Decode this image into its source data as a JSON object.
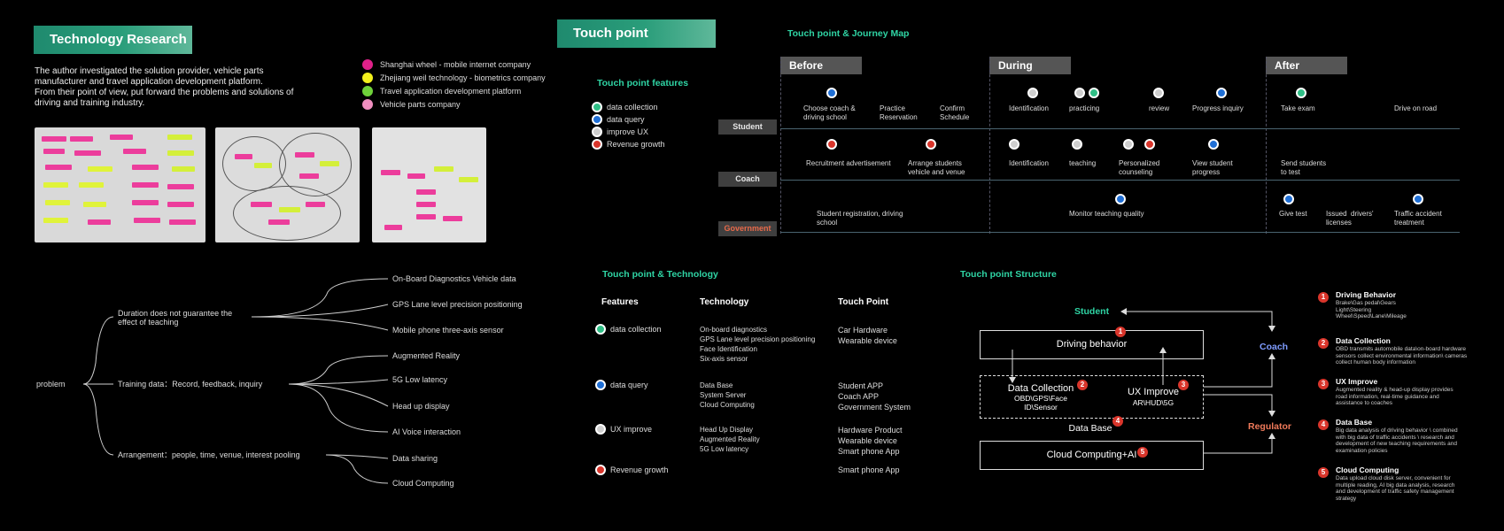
{
  "tech_research": {
    "header": "Technology Research",
    "intro": [
      "The author investigated the solution provider, vehicle parts",
      "manufacturer and travel application development platform.",
      "From their point of view, put forward the problems and solutions of",
      "driving and training industry."
    ],
    "legend": [
      {
        "label": "Shanghai wheel - mobile internet company",
        "color": "#e0218a"
      },
      {
        "label": "Zhejiang weil technology - biometrics company",
        "color": "#f2f01c"
      },
      {
        "label": "Travel application development platform",
        "color": "#6fd13a"
      },
      {
        "label": "Vehicle parts company",
        "color": "#f08fc0"
      }
    ]
  },
  "problem_tree": {
    "root": "problem",
    "branches": [
      {
        "label": "Duration does not guarantee the\neffect of teaching",
        "leaves": [
          "On-Board Diagnostics Vehicle data",
          "GPS Lane level precision positioning",
          "Mobile phone three-axis sensor"
        ]
      },
      {
        "label": "Training data：Record, feedback, inquiry",
        "leaves": [
          "Augmented Reality",
          "5G Low latency",
          "Head up display",
          "AI Voice interaction"
        ]
      },
      {
        "label": "Arrangement：people, time, venue,  interest pooling",
        "leaves": [
          "Data sharing",
          "Cloud Computing"
        ]
      }
    ]
  },
  "touch_point": {
    "header": "Touch point",
    "features_title": "Touch point features",
    "features": [
      {
        "label": "data collection",
        "color": "green"
      },
      {
        "label": "data query",
        "color": "blue"
      },
      {
        "label": "improve UX",
        "color": "white"
      },
      {
        "label": "Revenue growth",
        "color": "red"
      }
    ]
  },
  "journey": {
    "title": "Touch point & Journey Map",
    "phases": [
      "Before",
      "During",
      "After"
    ],
    "roles": [
      "Student",
      "Coach",
      "Government"
    ],
    "student": [
      "Choose coach &\ndriving school",
      "Practice\nReservation",
      "Confirm\nSchedule",
      "Identification",
      "practicing",
      "review",
      "Progress inquiry",
      "Take exam",
      "Drive on road"
    ],
    "coach": [
      "Recruitment advertisement",
      "Arrange students\nvehicle and venue",
      "Identification",
      "teaching",
      "Personalized\ncounseling",
      "View student\nprogress",
      "Send students\nto test"
    ],
    "government": [
      "Student registration, driving\nschool",
      "Monitor teaching quality",
      "Give test",
      "Issued  drivers'\nlicenses",
      "Traffic accident\ntreatment"
    ]
  },
  "tech_table": {
    "title": "Touch point & Technology",
    "headers": [
      "Features",
      "Technology",
      "Touch Point"
    ],
    "rows": [
      {
        "feature": "data collection",
        "color": "green",
        "tech": [
          "On-board diagnostics",
          "GPS Lane level precision positioning",
          "Face Identification",
          "Six-axis sensor"
        ],
        "touch": [
          "Car Hardware",
          "Wearable device"
        ]
      },
      {
        "feature": "data query",
        "color": "blue",
        "tech": [
          "Data Base",
          "System Server",
          "Cloud Computing"
        ],
        "touch": [
          "Student APP",
          "Coach APP",
          "Government System"
        ]
      },
      {
        "feature": "UX improve",
        "color": "white",
        "tech": [
          "Head Up Display",
          "Augmented Reality",
          "5G Low latency"
        ],
        "touch": [
          "Hardware Product",
          "Wearable device",
          "Smart phone App"
        ]
      },
      {
        "feature": "Revenue growth",
        "color": "red",
        "tech": [],
        "touch": [
          "Smart phone App"
        ]
      }
    ]
  },
  "structure": {
    "title": "Touch point  Structure",
    "student": "Student",
    "coach": "Coach",
    "regulator": "Regulator",
    "driving_behavior": "Driving behavior",
    "data_collection": "Data Collection",
    "data_collection_sub": [
      "OBD\\GPS\\Face",
      "ID\\Sensor"
    ],
    "ux_improve": "UX Improve",
    "ux_improve_sub": "AR\\HUD\\5G",
    "data_base": "Data Base",
    "cloud": "Cloud Computing+AI",
    "notes": [
      {
        "n": "1",
        "title": "Driving Behavior",
        "text": [
          "Brake\\Gas pedal\\Gears",
          "Light\\Steering",
          "Wheel\\Speed\\Lane\\Mileage"
        ]
      },
      {
        "n": "2",
        "title": "Data Collection",
        "text": [
          "OBD transmits automobile data\\on-board hardware",
          "sensors collect environmental information\\ cameras",
          "collect human body information"
        ]
      },
      {
        "n": "3",
        "title": "UX Improve",
        "text": [
          "Augmented reality & head-up display provides",
          "road information, real-time guidance and",
          "assistance to coaches"
        ]
      },
      {
        "n": "4",
        "title": "Data Base",
        "text": [
          "Big data analysis of driving behavior \\ combined",
          "with big data of traffic accidents \\ research and",
          "development of new teaching requirements and",
          "examination policies"
        ]
      },
      {
        "n": "5",
        "title": "Cloud Computing",
        "text": [
          "Data upload cloud disk server, convenient for",
          "multiple reading, AI big data analysis, research",
          "and development of traffic safety management",
          "strategy"
        ]
      }
    ]
  }
}
